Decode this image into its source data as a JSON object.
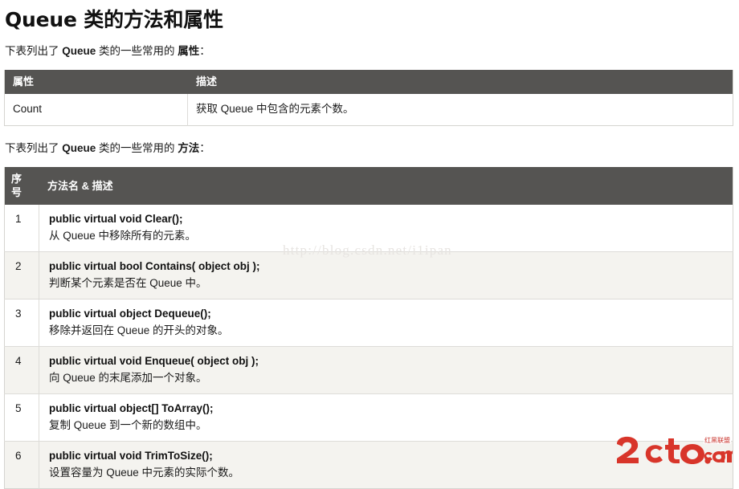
{
  "page": {
    "title": "Queue 类的方法和属性"
  },
  "properties_section": {
    "intro_prefix": "下表列出了 ",
    "intro_keyword": "Queue",
    "intro_middle": " 类的一些常用的 ",
    "intro_suffix_keyword": "属性",
    "intro_end": "：",
    "table": {
      "headers": [
        "属性",
        "描述"
      ],
      "rows": [
        {
          "name": "Count",
          "desc": "获取 Queue 中包含的元素个数。"
        }
      ]
    }
  },
  "methods_section": {
    "intro_prefix": "下表列出了 ",
    "intro_keyword": "Queue",
    "intro_middle": " 类的一些常用的 ",
    "intro_suffix_keyword": "方法",
    "intro_end": "：",
    "table": {
      "headers": [
        "序号",
        "方法名 & 描述"
      ],
      "rows": [
        {
          "index": "1",
          "signature": "public virtual void Clear();",
          "desc": "从 Queue 中移除所有的元素。"
        },
        {
          "index": "2",
          "signature": "public virtual bool Contains( object obj );",
          "desc": "判断某个元素是否在 Queue 中。"
        },
        {
          "index": "3",
          "signature": "public virtual object Dequeue();",
          "desc": "移除并返回在 Queue 的开头的对象。"
        },
        {
          "index": "4",
          "signature": "public virtual void Enqueue( object obj );",
          "desc": "向 Queue 的末尾添加一个对象。"
        },
        {
          "index": "5",
          "signature": "public virtual object[] ToArray();",
          "desc": "复制 Queue 到一个新的数组中。"
        },
        {
          "index": "6",
          "signature": "public virtual void TrimToSize();",
          "desc": "设置容量为 Queue 中元素的实际个数。"
        }
      ]
    }
  },
  "watermark": {
    "text": "http://blog.csdn.net/i1ipan"
  },
  "logo": {
    "wordmark": "2cto",
    "suffix": ".com",
    "badge": "红黑联盟",
    "color": "#d8352a"
  },
  "colors": {
    "header_bg": "#555452",
    "header_text": "#ffffff",
    "alt_row_bg": "#f4f3ef",
    "border": "#dddcd8",
    "text": "#1a1a1a"
  }
}
